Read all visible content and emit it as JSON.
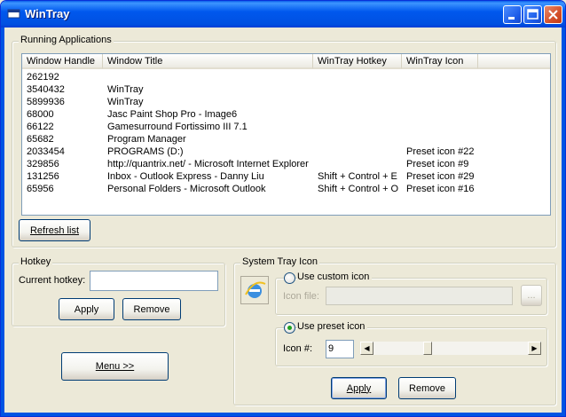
{
  "window": {
    "title": "WinTray"
  },
  "running_apps": {
    "group_label": "Running Applications",
    "columns": [
      "Window Handle",
      "Window Title",
      "WinTray Hotkey",
      "WinTray Icon"
    ],
    "rows": [
      {
        "handle": "262192",
        "title": "",
        "hotkey": "",
        "icon": ""
      },
      {
        "handle": "3540432",
        "title": "WinTray",
        "hotkey": "",
        "icon": ""
      },
      {
        "handle": "5899936",
        "title": "WinTray",
        "hotkey": "",
        "icon": ""
      },
      {
        "handle": "68000",
        "title": "Jasc Paint Shop Pro - Image6",
        "hotkey": "",
        "icon": ""
      },
      {
        "handle": "66122",
        "title": "Gamesurround Fortissimo III 7.1",
        "hotkey": "",
        "icon": ""
      },
      {
        "handle": "65682",
        "title": "Program Manager",
        "hotkey": "",
        "icon": ""
      },
      {
        "handle": "2033454",
        "title": "PROGRAMS (D:)",
        "hotkey": "",
        "icon": "Preset icon #22"
      },
      {
        "handle": "329856",
        "title": "http://quantrix.net/ - Microsoft Internet Explorer",
        "hotkey": "",
        "icon": "Preset icon #9"
      },
      {
        "handle": "131256",
        "title": "Inbox - Outlook Express - Danny Liu",
        "hotkey": "Shift + Control + E",
        "icon": "Preset icon #29"
      },
      {
        "handle": "65956",
        "title": "Personal Folders - Microsoft Outlook",
        "hotkey": "Shift + Control + O",
        "icon": "Preset icon #16"
      }
    ],
    "refresh_label": "Refresh list"
  },
  "hotkey": {
    "group_label": "Hotkey",
    "current_label": "Current hotkey:",
    "current_value": "",
    "apply_label": "Apply",
    "remove_label": "Remove"
  },
  "menu_label": "Menu >>",
  "tray_icon": {
    "group_label": "System Tray Icon",
    "use_custom_label": "Use custom icon",
    "icon_file_label": "Icon file:",
    "icon_file_value": "",
    "browse_label": "...",
    "use_preset_label": "Use preset icon",
    "icon_num_label": "Icon #:",
    "icon_num_value": "9",
    "preset_slider_fraction": 0.34,
    "apply_label": "Apply",
    "remove_label": "Remove"
  },
  "colors": {
    "titlebar": "#0054E3",
    "face": "#ECE9D8"
  }
}
